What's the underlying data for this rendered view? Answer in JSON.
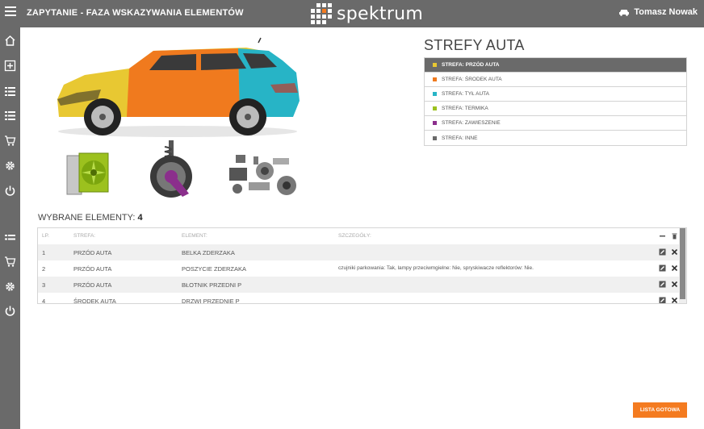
{
  "header": {
    "title": "ZAPYTANIE - FAZA WSKAZYWANIA ELEMENTÓW",
    "logo_text": "spektrum",
    "user_name": "Tomasz Nowak"
  },
  "sidebar": {
    "icons": [
      "home-icon",
      "add-icon",
      "list-icon",
      "list-icon",
      "cart-icon",
      "gear-icon",
      "power-icon",
      "list-icon",
      "cart-icon",
      "gear-icon",
      "power-icon"
    ]
  },
  "zones": {
    "title": "STREFY AUTA",
    "items": [
      {
        "label": "STREFA: PRZÓD AUTA",
        "color": "#e8c832",
        "active": true
      },
      {
        "label": "STREFA: ŚRODEK AUTA",
        "color": "#f07a1e",
        "active": false
      },
      {
        "label": "STREFA: TYŁ AUTA",
        "color": "#27b4c6",
        "active": false
      },
      {
        "label": "STREFA: TERMIKA",
        "color": "#9cc11e",
        "active": false
      },
      {
        "label": "STREFA: ZAWIESZENIE",
        "color": "#8b2f8c",
        "active": false
      },
      {
        "label": "STREFA: INNE",
        "color": "#6a6a6a",
        "active": false
      }
    ]
  },
  "selected": {
    "label": "WYBRANE ELEMENTY:",
    "count": "4"
  },
  "table": {
    "headers": {
      "lp": "LP.",
      "strefa": "STREFA:",
      "element": "ELEMENT:",
      "szczegoly": "SZCZEGÓŁY:"
    },
    "rows": [
      {
        "lp": "1",
        "strefa": "PRZÓD AUTA",
        "element": "BELKA ZDERZAKA",
        "szczegoly": ""
      },
      {
        "lp": "2",
        "strefa": "PRZÓD AUTA",
        "element": "POSZYCIE ZDERZAKA",
        "szczegoly": "czujniki parkowania: Tak, lampy przeciwmgielne: Nie, spryskiwacze reflektorów: Nie."
      },
      {
        "lp": "3",
        "strefa": "PRZÓD AUTA",
        "element": "BŁOTNIK PRZEDNI P",
        "szczegoly": ""
      },
      {
        "lp": "4",
        "strefa": "ŚRODEK AUTA",
        "element": "DRZWI PRZEDNIE P",
        "szczegoly": ""
      }
    ]
  },
  "actions": {
    "done_label": "LISTA GOTOWA"
  },
  "colors": {
    "accent": "#f47b20",
    "header_bg": "#6a6a6a"
  }
}
